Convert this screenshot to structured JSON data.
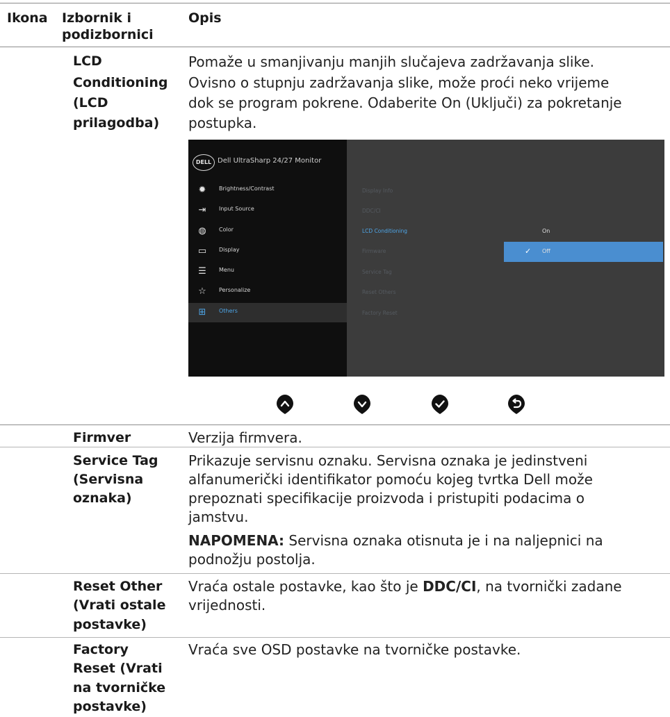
{
  "header": {
    "col_icon": "Ikona",
    "col_menu_line1": "Izbornik i",
    "col_menu_line2": "podizbornici",
    "col_desc": "Opis"
  },
  "rows": {
    "lcd": {
      "name_lines": [
        "LCD",
        "Conditioning",
        "(LCD",
        "prilagodba)"
      ],
      "desc_lines": [
        "Pomaže u smanjivanju manjih slučajeva zadržavanja slike.",
        "Ovisno o stupnju zadržavanja slike, može proći neko vrijeme",
        "dok se program pokrene. Odaberite On (Uključi) za pokretanje",
        "postupka."
      ]
    },
    "firmware": {
      "name": "Firmver",
      "desc": "Verzija firmvera."
    },
    "service_tag": {
      "name_lines": [
        "Service Tag",
        "(Servisna",
        "oznaka)"
      ],
      "desc_lines": [
        "Prikazuje servisnu oznaku. Servisna oznaka je jedinstveni",
        "alfanumerički identifikator pomoću kojeg tvrtka Dell može",
        "prepoznati specifikacije proizvoda i pristupiti podacima o",
        "jamstvu."
      ],
      "note_label": "NAPOMENA:",
      "note_rest": " Servisna oznaka otisnuta je i na naljepnici na",
      "note_line2": "podnožju postolja."
    },
    "reset_other": {
      "name_lines": [
        "Reset Other",
        "(Vrati ostale",
        "postavke)"
      ],
      "desc_pre": "Vraća ostale postavke, kao što je ",
      "desc_bold": "DDC/CI",
      "desc_post": ", na tvornički zadane",
      "desc_line2": "vrijednosti."
    },
    "factory_reset": {
      "name_lines": [
        "Factory",
        "Reset (Vrati",
        "na tvorničke",
        "postavke)"
      ],
      "desc": "Vraća sve OSD postavke na tvorničke postavke."
    }
  },
  "osd": {
    "logo": "DELL",
    "title": "Dell UltraSharp 24/27 Monitor",
    "menu": [
      {
        "label": "Brightness/Contrast",
        "icon": "sun-icon"
      },
      {
        "label": "Input Source",
        "icon": "input-icon"
      },
      {
        "label": "Color",
        "icon": "palette-icon"
      },
      {
        "label": "Display",
        "icon": "monitor-icon"
      },
      {
        "label": "Menu",
        "icon": "menu-icon"
      },
      {
        "label": "Personalize",
        "icon": "star-icon"
      },
      {
        "label": "Others",
        "icon": "others-icon"
      }
    ],
    "submenu": [
      "Display Info",
      "DDC/CI",
      "LCD Conditioning",
      "Firmware",
      "Service Tag",
      "Reset Others",
      "Factory Reset"
    ],
    "options": [
      "On",
      "Off"
    ],
    "selected_option": "Off",
    "active_menu": "Others",
    "active_submenu": "LCD Conditioning",
    "accent_color": "#4a8ed0"
  },
  "buttons": [
    "up-button",
    "down-button",
    "ok-button",
    "back-button"
  ]
}
